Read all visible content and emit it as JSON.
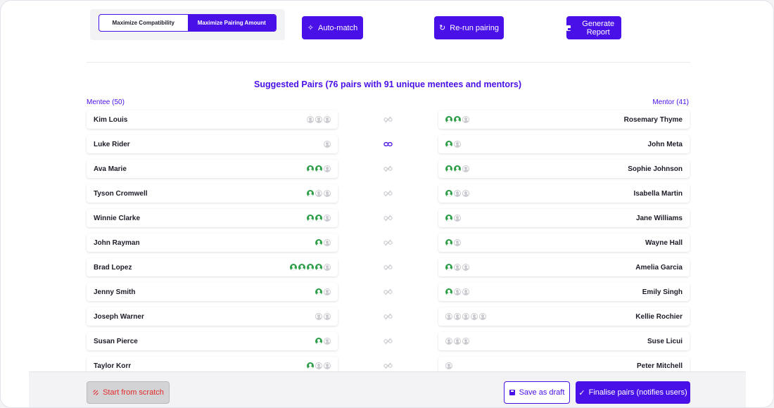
{
  "toggle": {
    "option1": "Maximize Compatibility",
    "option2": "Maximize Pairing Amount",
    "active": "Maximize Pairing Amount"
  },
  "buttons": {
    "auto_match": "Auto-match",
    "rerun": "Re-run pairing",
    "report": "Generate Report"
  },
  "title": "Suggested Pairs (76 pairs with 91 unique mentees and mentors)",
  "mentee_header": "Mentee (50)",
  "mentor_header": "Mentor (41)",
  "pairs": [
    {
      "mentee": "Kim Louis",
      "mentee_on": 0,
      "mentee_off": 3,
      "mentor": "Rosemary Thyme",
      "mentor_on": 2,
      "mentor_off": 1,
      "linked": false
    },
    {
      "mentee": "Luke Rider",
      "mentee_on": 0,
      "mentee_off": 1,
      "mentor": "John Meta",
      "mentor_on": 1,
      "mentor_off": 1,
      "linked": true
    },
    {
      "mentee": "Ava Marie",
      "mentee_on": 2,
      "mentee_off": 1,
      "mentor": "Sophie Johnson",
      "mentor_on": 2,
      "mentor_off": 1,
      "linked": false
    },
    {
      "mentee": "Tyson Cromwell",
      "mentee_on": 1,
      "mentee_off": 2,
      "mentor": "Isabella Martin",
      "mentor_on": 1,
      "mentor_off": 2,
      "linked": false
    },
    {
      "mentee": "Winnie Clarke",
      "mentee_on": 2,
      "mentee_off": 1,
      "mentor": "Jane Williams",
      "mentor_on": 1,
      "mentor_off": 1,
      "linked": false
    },
    {
      "mentee": "John Rayman",
      "mentee_on": 1,
      "mentee_off": 1,
      "mentor": "Wayne Hall",
      "mentor_on": 1,
      "mentor_off": 1,
      "linked": false
    },
    {
      "mentee": "Brad Lopez",
      "mentee_on": 4,
      "mentee_off": 1,
      "mentor": "Amelia Garcia",
      "mentor_on": 1,
      "mentor_off": 2,
      "linked": false
    },
    {
      "mentee": "Jenny Smith",
      "mentee_on": 1,
      "mentee_off": 1,
      "mentor": "Emily Singh",
      "mentor_on": 1,
      "mentor_off": 2,
      "linked": false
    },
    {
      "mentee": "Joseph Warner",
      "mentee_on": 0,
      "mentee_off": 2,
      "mentor": "Kellie Rochier",
      "mentor_on": 0,
      "mentor_off": 5,
      "linked": false
    },
    {
      "mentee": "Susan Pierce",
      "mentee_on": 1,
      "mentee_off": 1,
      "mentor": "Suse Licui",
      "mentor_on": 0,
      "mentor_off": 3,
      "linked": false
    },
    {
      "mentee": "Taylor Korr",
      "mentee_on": 1,
      "mentee_off": 2,
      "mentor": "Peter Mitchell",
      "mentor_on": 0,
      "mentor_off": 1,
      "linked": false
    }
  ],
  "footer": {
    "scratch": "Start from scratch",
    "save_draft": "Save as draft",
    "finalise": "Finalise pairs (notifies users)"
  },
  "colors": {
    "accent": "#4a10e8",
    "avatar_on": "#2e9e48",
    "avatar_off": "#c9c9d0",
    "danger": "#e02a2a"
  }
}
